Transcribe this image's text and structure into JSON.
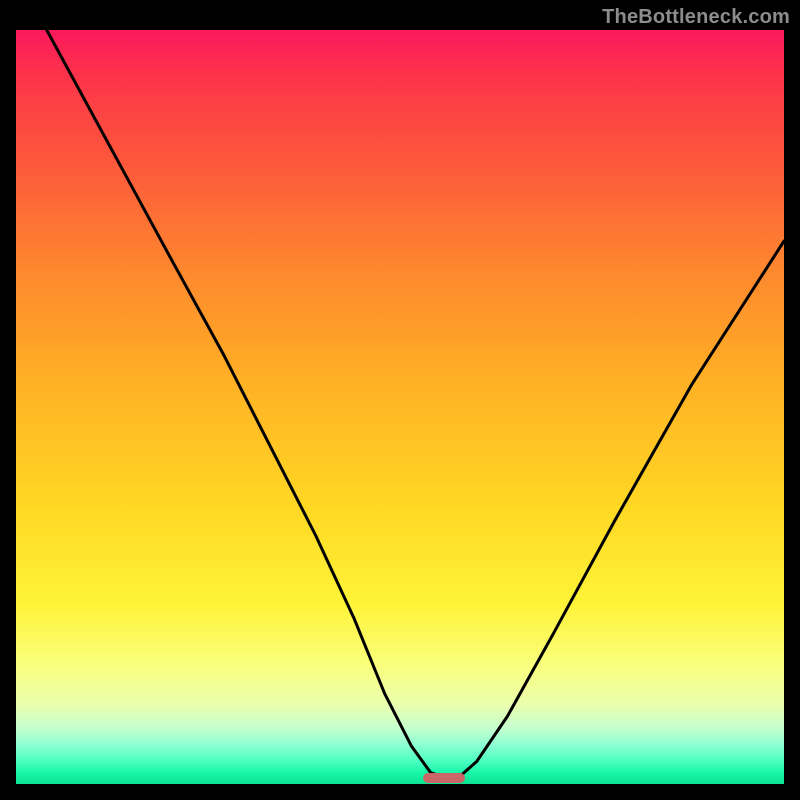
{
  "watermark": "TheBottleneck.com",
  "chart_data": {
    "type": "line",
    "title": "",
    "xlabel": "",
    "ylabel": "",
    "xlim": [
      0,
      100
    ],
    "ylim": [
      0,
      100
    ],
    "series": [
      {
        "name": "bottleneck-curve",
        "x": [
          4,
          12,
          20,
          27,
          33,
          39,
          44,
          48,
          51.5,
          54,
          56,
          58,
          60,
          64,
          70,
          78,
          88,
          100
        ],
        "values": [
          100,
          85,
          70,
          57,
          45,
          33,
          22,
          12,
          5,
          1.5,
          0.8,
          1.2,
          3,
          9,
          20,
          35,
          53,
          72
        ]
      }
    ],
    "marker": {
      "x_start": 53,
      "x_end": 58.5,
      "y": 0.8
    },
    "gradient_stops": [
      {
        "pct": 0,
        "color": "#fb195b"
      },
      {
        "pct": 7,
        "color": "#fc3748"
      },
      {
        "pct": 18,
        "color": "#fd593b"
      },
      {
        "pct": 33,
        "color": "#fe8b2d"
      },
      {
        "pct": 48,
        "color": "#ffb424"
      },
      {
        "pct": 63,
        "color": "#ffd723"
      },
      {
        "pct": 76,
        "color": "#fef337"
      },
      {
        "pct": 84,
        "color": "#faff7a"
      },
      {
        "pct": 89.5,
        "color": "#e9ffae"
      },
      {
        "pct": 92.5,
        "color": "#c7ffce"
      },
      {
        "pct": 95,
        "color": "#87ffd1"
      },
      {
        "pct": 97,
        "color": "#4affc1"
      },
      {
        "pct": 98.5,
        "color": "#18f7a9"
      },
      {
        "pct": 100,
        "color": "#0ce294"
      }
    ]
  }
}
